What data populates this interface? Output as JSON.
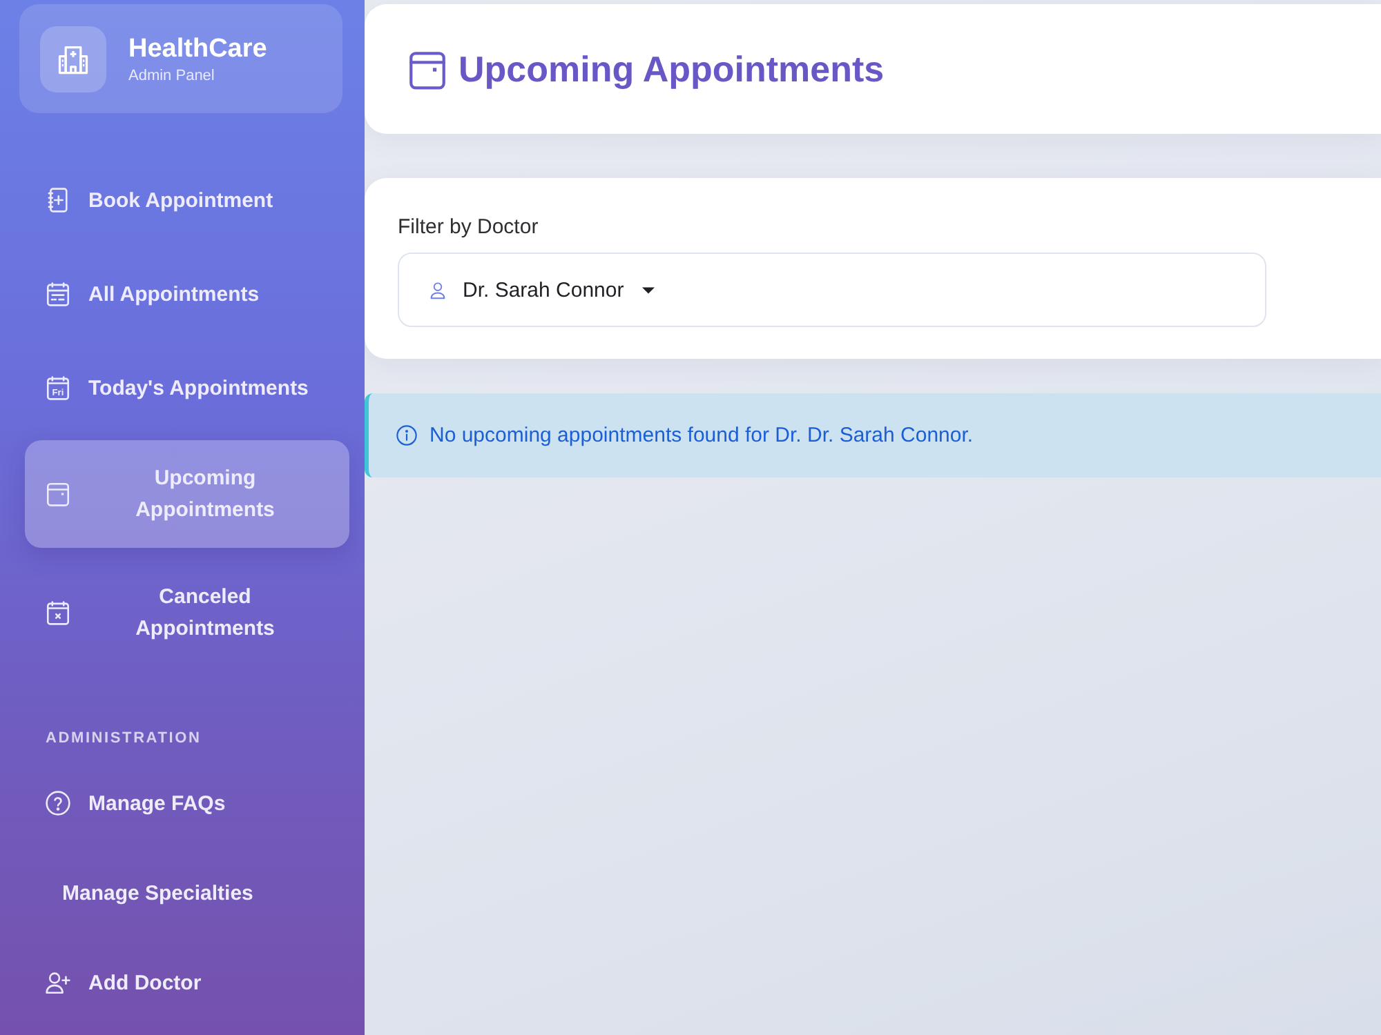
{
  "sidebar": {
    "brand": {
      "title": "HealthCare",
      "subtitle": "Admin Panel"
    },
    "items": [
      {
        "label": "Book Appointment",
        "selected": false
      },
      {
        "label": "All Appointments",
        "selected": false
      },
      {
        "label": "Today's Appointments",
        "icon_text": "Fri",
        "selected": false
      },
      {
        "label": "Upcoming Appointments",
        "selected": true
      },
      {
        "label": "Canceled Appointments",
        "selected": false
      }
    ],
    "sections": [
      {
        "heading": "ADMINISTRATION",
        "items": [
          {
            "label": "Manage FAQs",
            "selected": false
          },
          {
            "label": "Manage Specialties",
            "selected": false
          },
          {
            "label": "Add Doctor",
            "selected": false
          }
        ]
      }
    ]
  },
  "header": {
    "title": "Upcoming Appointments"
  },
  "filter": {
    "label": "Filter by Doctor",
    "value": "Dr. Sarah Connor"
  },
  "alert": {
    "message": "No upcoming appointments found for Dr. Dr. Sarah Connor."
  }
}
